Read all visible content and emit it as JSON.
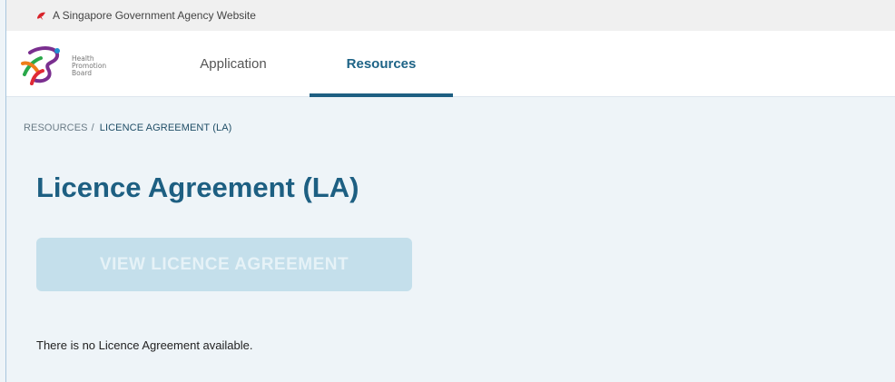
{
  "gov_bar": {
    "text": "A Singapore Government Agency Website",
    "icon": "singapore-lion-icon",
    "icon_color": "#d8232a"
  },
  "logo": {
    "line1": "Health",
    "line2": "Promotion",
    "line3": "Board",
    "icon": "hpb-logo"
  },
  "nav": {
    "items": [
      {
        "label": "Application",
        "active": false
      },
      {
        "label": "Resources",
        "active": true
      }
    ],
    "accent": "#1e5f82"
  },
  "breadcrumb": {
    "root": "RESOURCES",
    "separator": "/",
    "current": "LICENCE AGREEMENT (LA)"
  },
  "page": {
    "title": "Licence Agreement (LA)",
    "button_label": "VIEW LICENCE AGREEMENT",
    "button_state": "disabled",
    "empty_message": "There is no Licence Agreement available."
  },
  "colors": {
    "background": "#eef4f8",
    "title": "#1d5f82",
    "button_disabled": "#c4dfeb"
  }
}
